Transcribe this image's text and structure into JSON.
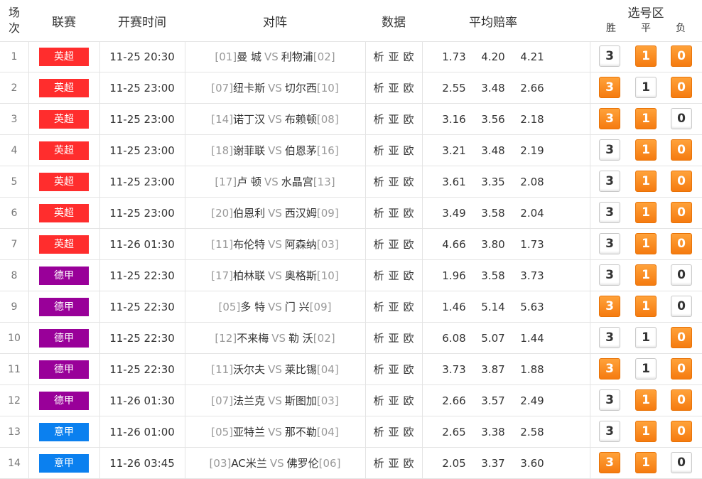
{
  "header": {
    "idx": [
      "场",
      "次"
    ],
    "league": "联赛",
    "time": "开赛时间",
    "match": "对阵",
    "data": "数据",
    "odds": "平均赔率",
    "pick_title": "选号区",
    "pick_win": "胜",
    "pick_draw": "平",
    "pick_lose": "负"
  },
  "data_links": [
    "析",
    "亚",
    "欧"
  ],
  "vs": "VS",
  "league_colors": {
    "英超": "#ff2d2d",
    "德甲": "#990099",
    "意甲": "#0b80ef"
  },
  "rows": [
    {
      "idx": "1",
      "league": "英超",
      "time": "11-25 20:30",
      "home_rank": "[01]",
      "home": "曼 城",
      "away": "利物浦",
      "away_rank": "[02]",
      "odds": [
        "1.73",
        "4.20",
        "4.21"
      ],
      "picks": [
        "3",
        "1",
        "0"
      ],
      "selected": [
        false,
        true,
        true
      ]
    },
    {
      "idx": "2",
      "league": "英超",
      "time": "11-25 23:00",
      "home_rank": "[07]",
      "home": "纽卡斯",
      "away": "切尔西",
      "away_rank": "[10]",
      "odds": [
        "2.55",
        "3.48",
        "2.66"
      ],
      "picks": [
        "3",
        "1",
        "0"
      ],
      "selected": [
        true,
        false,
        true
      ]
    },
    {
      "idx": "3",
      "league": "英超",
      "time": "11-25 23:00",
      "home_rank": "[14]",
      "home": "诺丁汉",
      "away": "布赖顿",
      "away_rank": "[08]",
      "odds": [
        "3.16",
        "3.56",
        "2.18"
      ],
      "picks": [
        "3",
        "1",
        "0"
      ],
      "selected": [
        true,
        true,
        false
      ]
    },
    {
      "idx": "4",
      "league": "英超",
      "time": "11-25 23:00",
      "home_rank": "[18]",
      "home": "谢菲联",
      "away": "伯恩茅",
      "away_rank": "[16]",
      "odds": [
        "3.21",
        "3.48",
        "2.19"
      ],
      "picks": [
        "3",
        "1",
        "0"
      ],
      "selected": [
        false,
        true,
        true
      ]
    },
    {
      "idx": "5",
      "league": "英超",
      "time": "11-25 23:00",
      "home_rank": "[17]",
      "home": "卢 顿",
      "away": "水晶宫",
      "away_rank": "[13]",
      "odds": [
        "3.61",
        "3.35",
        "2.08"
      ],
      "picks": [
        "3",
        "1",
        "0"
      ],
      "selected": [
        false,
        true,
        true
      ]
    },
    {
      "idx": "6",
      "league": "英超",
      "time": "11-25 23:00",
      "home_rank": "[20]",
      "home": "伯恩利",
      "away": "西汉姆",
      "away_rank": "[09]",
      "odds": [
        "3.49",
        "3.58",
        "2.04"
      ],
      "picks": [
        "3",
        "1",
        "0"
      ],
      "selected": [
        false,
        true,
        true
      ]
    },
    {
      "idx": "7",
      "league": "英超",
      "time": "11-26 01:30",
      "home_rank": "[11]",
      "home": "布伦特",
      "away": "阿森纳",
      "away_rank": "[03]",
      "odds": [
        "4.66",
        "3.80",
        "1.73"
      ],
      "picks": [
        "3",
        "1",
        "0"
      ],
      "selected": [
        false,
        true,
        true
      ]
    },
    {
      "idx": "8",
      "league": "德甲",
      "time": "11-25 22:30",
      "home_rank": "[17]",
      "home": "柏林联",
      "away": "奥格斯",
      "away_rank": "[10]",
      "odds": [
        "1.96",
        "3.58",
        "3.73"
      ],
      "picks": [
        "3",
        "1",
        "0"
      ],
      "selected": [
        false,
        true,
        false
      ]
    },
    {
      "idx": "9",
      "league": "德甲",
      "time": "11-25 22:30",
      "home_rank": "[05]",
      "home": "多 特",
      "away": "门 兴",
      "away_rank": "[09]",
      "odds": [
        "1.46",
        "5.14",
        "5.63"
      ],
      "picks": [
        "3",
        "1",
        "0"
      ],
      "selected": [
        true,
        true,
        false
      ]
    },
    {
      "idx": "10",
      "league": "德甲",
      "time": "11-25 22:30",
      "home_rank": "[12]",
      "home": "不来梅",
      "away": "勒 沃",
      "away_rank": "[02]",
      "odds": [
        "6.08",
        "5.07",
        "1.44"
      ],
      "picks": [
        "3",
        "1",
        "0"
      ],
      "selected": [
        false,
        false,
        true
      ]
    },
    {
      "idx": "11",
      "league": "德甲",
      "time": "11-25 22:30",
      "home_rank": "[11]",
      "home": "沃尔夫",
      "away": "莱比锡",
      "away_rank": "[04]",
      "odds": [
        "3.73",
        "3.87",
        "1.88"
      ],
      "picks": [
        "3",
        "1",
        "0"
      ],
      "selected": [
        true,
        false,
        true
      ]
    },
    {
      "idx": "12",
      "league": "德甲",
      "time": "11-26 01:30",
      "home_rank": "[07]",
      "home": "法兰克",
      "away": "斯图加",
      "away_rank": "[03]",
      "odds": [
        "2.66",
        "3.57",
        "2.49"
      ],
      "picks": [
        "3",
        "1",
        "0"
      ],
      "selected": [
        false,
        true,
        true
      ]
    },
    {
      "idx": "13",
      "league": "意甲",
      "time": "11-26 01:00",
      "home_rank": "[05]",
      "home": "亚特兰",
      "away": "那不勒",
      "away_rank": "[04]",
      "odds": [
        "2.65",
        "3.38",
        "2.58"
      ],
      "picks": [
        "3",
        "1",
        "0"
      ],
      "selected": [
        false,
        true,
        true
      ]
    },
    {
      "idx": "14",
      "league": "意甲",
      "time": "11-26 03:45",
      "home_rank": "[03]",
      "home": "AC米兰",
      "away": "佛罗伦",
      "away_rank": "[06]",
      "odds": [
        "2.05",
        "3.37",
        "3.60"
      ],
      "picks": [
        "3",
        "1",
        "0"
      ],
      "selected": [
        true,
        true,
        false
      ]
    }
  ]
}
